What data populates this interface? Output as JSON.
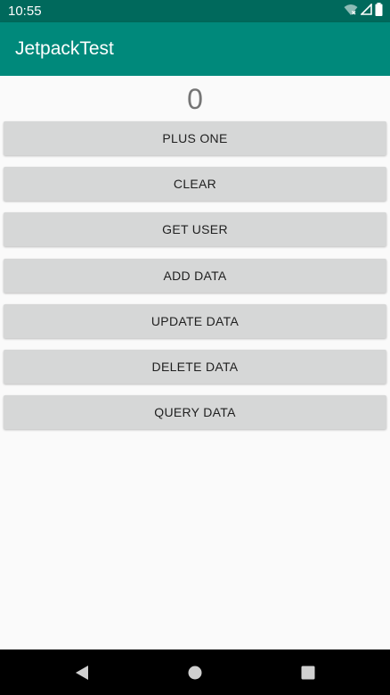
{
  "status_bar": {
    "time": "10:55",
    "icons": [
      "wifi-icon",
      "cell-signal-icon",
      "battery-icon"
    ],
    "color": "#00695c"
  },
  "app_bar": {
    "title": "JetpackTest",
    "color": "#00897b"
  },
  "main": {
    "counter_value": "0",
    "buttons": [
      {
        "label": "PLUS ONE"
      },
      {
        "label": "CLEAR"
      },
      {
        "label": "GET USER"
      },
      {
        "label": "ADD DATA"
      },
      {
        "label": "UPDATE DATA"
      },
      {
        "label": "DELETE DATA"
      },
      {
        "label": "QUERY DATA"
      }
    ]
  },
  "nav_bar": {
    "icons": [
      "back-icon",
      "home-icon",
      "recents-icon"
    ]
  }
}
